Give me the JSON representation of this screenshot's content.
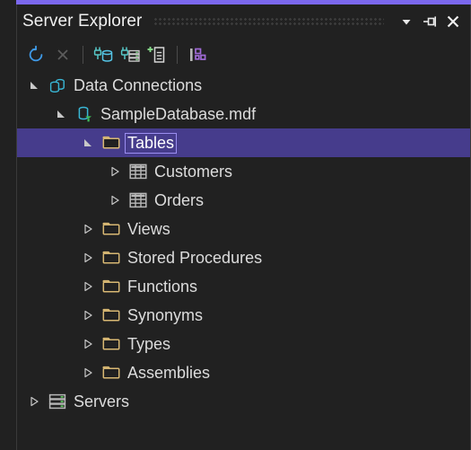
{
  "window": {
    "title": "Server Explorer",
    "accent_color": "#7b68ee",
    "background_color": "#212121",
    "selection_color": "#463c8c",
    "grip_name": "drag-grip"
  },
  "header": {
    "buttons": [
      {
        "name": "chevron-down-icon",
        "label": "▼",
        "tooltip": "Window options"
      },
      {
        "name": "pin-icon",
        "label": "",
        "tooltip": "Auto Hide"
      },
      {
        "name": "close-icon",
        "label": "✕",
        "tooltip": "Close"
      }
    ]
  },
  "toolbar": {
    "items": [
      {
        "name": "refresh-button",
        "label": "Refresh",
        "color": "#3f9ae8",
        "enabled": true
      },
      {
        "name": "stop-button",
        "label": "Stop",
        "color": "#6a6a6a",
        "enabled": false
      },
      {
        "name": "separator-1",
        "label": "",
        "type": "separator"
      },
      {
        "name": "connect-to-database-button",
        "label": "Connect to Database",
        "color": "#57c8c8",
        "enabled": true
      },
      {
        "name": "connect-to-server-button",
        "label": "Connect to Server",
        "color": "#57c8c8",
        "enabled": true
      },
      {
        "name": "add-new-data-source-button",
        "label": "Add New Data Source",
        "color": "#86d98a",
        "enabled": true
      },
      {
        "name": "separator-2",
        "label": "",
        "type": "separator"
      },
      {
        "name": "object-hierarchy-button",
        "label": "Object Hierarchy",
        "color": "#a06bd6",
        "enabled": true
      }
    ]
  },
  "tree": {
    "nodes": [
      {
        "label": "Data Connections",
        "depth": 0,
        "icon": "databases-icon",
        "state": "expanded",
        "selected": false
      },
      {
        "label": "SampleDatabase.mdf",
        "depth": 1,
        "icon": "database-mdf-icon",
        "state": "expanded",
        "selected": false
      },
      {
        "label": "Tables",
        "depth": 2,
        "icon": "folder-icon",
        "state": "expanded",
        "selected": true
      },
      {
        "label": "Customers",
        "depth": 3,
        "icon": "table-icon",
        "state": "collapsed",
        "selected": false
      },
      {
        "label": "Orders",
        "depth": 3,
        "icon": "table-icon",
        "state": "collapsed",
        "selected": false
      },
      {
        "label": "Views",
        "depth": 2,
        "icon": "folder-icon",
        "state": "collapsed",
        "selected": false
      },
      {
        "label": "Stored Procedures",
        "depth": 2,
        "icon": "folder-icon",
        "state": "collapsed",
        "selected": false
      },
      {
        "label": "Functions",
        "depth": 2,
        "icon": "folder-icon",
        "state": "collapsed",
        "selected": false
      },
      {
        "label": "Synonyms",
        "depth": 2,
        "icon": "folder-icon",
        "state": "collapsed",
        "selected": false
      },
      {
        "label": "Types",
        "depth": 2,
        "icon": "folder-icon",
        "state": "collapsed",
        "selected": false
      },
      {
        "label": "Assemblies",
        "depth": 2,
        "icon": "folder-icon",
        "state": "collapsed",
        "selected": false
      },
      {
        "label": "Servers",
        "depth": 0,
        "icon": "servers-icon",
        "state": "collapsed",
        "selected": false
      }
    ]
  }
}
